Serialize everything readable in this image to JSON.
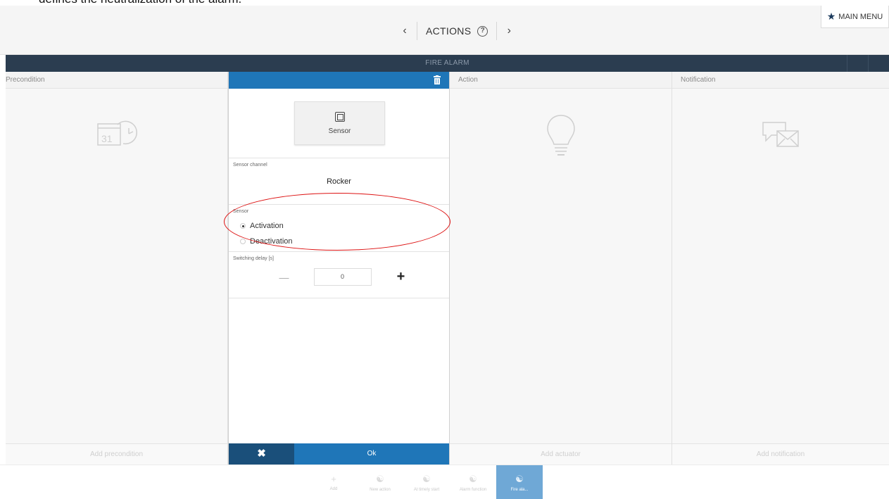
{
  "caption": "defines the neutralization of the alarm.",
  "header": {
    "title": "ACTIONS",
    "prev_icon": "chevron-left-icon",
    "next_icon": "chevron-right-icon",
    "help_icon": "help-circle-icon",
    "main_menu_label": "MAIN MENU"
  },
  "titlebar": {
    "title": "FIRE ALARM"
  },
  "panels": {
    "precondition": {
      "header": "Precondition",
      "icon": "calendar-icon",
      "footer": "Add precondition"
    },
    "action": {
      "header": "Action",
      "icon": "lightbulb-icon",
      "footer": "Add actuator"
    },
    "notification": {
      "header": "Notification",
      "icon": "message-icon",
      "footer": "Add notification"
    }
  },
  "editor": {
    "sensor_button_label": "Sensor",
    "sensor_channel_label": "Sensor channel",
    "sensor_channel_value": "Rocker",
    "sensor_label": "Sensor",
    "options": [
      {
        "label": "Activation",
        "selected": true
      },
      {
        "label": "Deactivation",
        "selected": false
      }
    ],
    "delay_label": "Switching delay [s]",
    "delay_value": "0",
    "ok_label": "Ok"
  },
  "bottom_tabs": [
    {
      "label": "Add",
      "icon": "plus-icon",
      "active": false
    },
    {
      "label": "New action",
      "icon": "action-icon",
      "active": false
    },
    {
      "label": "At timely start",
      "icon": "timer-icon",
      "active": false
    },
    {
      "label": "Alarm function",
      "icon": "alarm-icon",
      "active": false
    },
    {
      "label": "Fire ala...",
      "icon": "fire-alarm-icon",
      "active": true
    }
  ],
  "colors": {
    "accent": "#1f76b8",
    "titlebar": "#2b3d50",
    "highlight": "#d11111"
  }
}
